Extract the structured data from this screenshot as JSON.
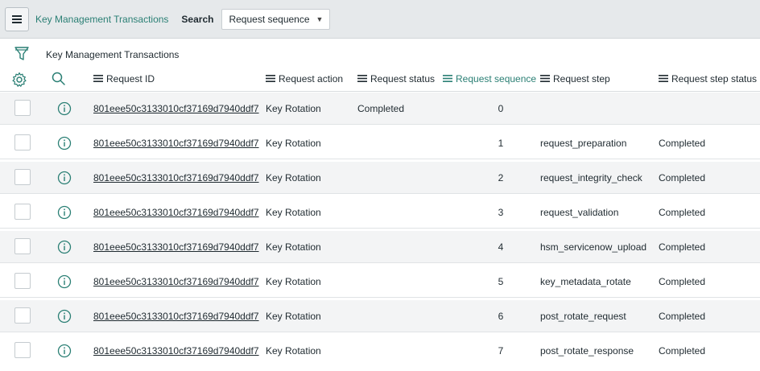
{
  "header": {
    "list_title": "Key Management Transactions",
    "search_label": "Search",
    "search_field": "Request sequence"
  },
  "breadcrumb": "Key Management Transactions",
  "columns": [
    "Request ID",
    "Request action",
    "Request status",
    "Request sequence",
    "Request step",
    "Request step status"
  ],
  "active_column": "Request sequence",
  "colors": {
    "accent": "#2a7f74",
    "topbar": "#e6e9eb",
    "row_alt": "#f3f4f5"
  },
  "icons": [
    "menu-icon",
    "filter-icon",
    "gear-icon",
    "search-icon",
    "info-icon",
    "list-icon"
  ],
  "rows": [
    {
      "request_id": "801eee50c3133010cf37169d7940ddf7",
      "action": "Key Rotation",
      "status": "Completed",
      "sequence": "0",
      "step": "",
      "step_status": ""
    },
    {
      "request_id": "801eee50c3133010cf37169d7940ddf7",
      "action": "Key Rotation",
      "status": "",
      "sequence": "1",
      "step": "request_preparation",
      "step_status": "Completed"
    },
    {
      "request_id": "801eee50c3133010cf37169d7940ddf7",
      "action": "Key Rotation",
      "status": "",
      "sequence": "2",
      "step": "request_integrity_check",
      "step_status": "Completed"
    },
    {
      "request_id": "801eee50c3133010cf37169d7940ddf7",
      "action": "Key Rotation",
      "status": "",
      "sequence": "3",
      "step": "request_validation",
      "step_status": "Completed"
    },
    {
      "request_id": "801eee50c3133010cf37169d7940ddf7",
      "action": "Key Rotation",
      "status": "",
      "sequence": "4",
      "step": "hsm_servicenow_upload",
      "step_status": "Completed"
    },
    {
      "request_id": "801eee50c3133010cf37169d7940ddf7",
      "action": "Key Rotation",
      "status": "",
      "sequence": "5",
      "step": "key_metadata_rotate",
      "step_status": "Completed"
    },
    {
      "request_id": "801eee50c3133010cf37169d7940ddf7",
      "action": "Key Rotation",
      "status": "",
      "sequence": "6",
      "step": "post_rotate_request",
      "step_status": "Completed"
    },
    {
      "request_id": "801eee50c3133010cf37169d7940ddf7",
      "action": "Key Rotation",
      "status": "",
      "sequence": "7",
      "step": "post_rotate_response",
      "step_status": "Completed"
    }
  ]
}
